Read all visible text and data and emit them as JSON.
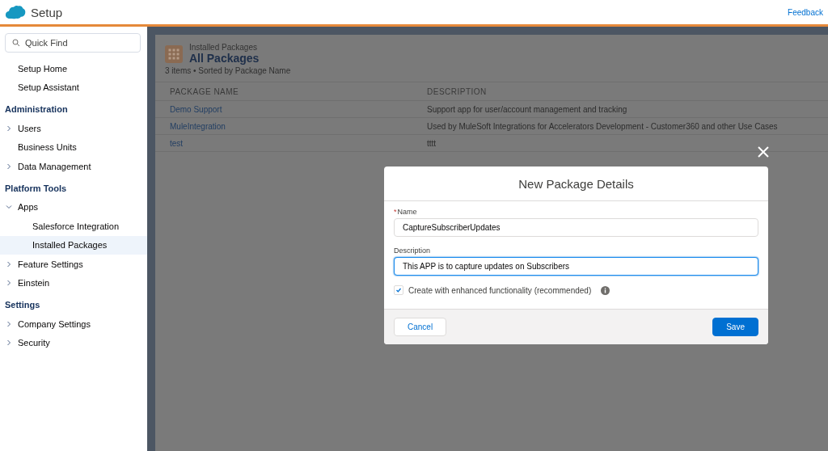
{
  "header": {
    "title": "Setup",
    "feedback_link": "Feedback"
  },
  "sidebar": {
    "search": {
      "placeholder": "Quick Find"
    },
    "groups": [
      {
        "items": [
          {
            "label": "Setup Home",
            "selected": false
          },
          {
            "label": "Setup Assistant",
            "selected": false
          }
        ]
      },
      {
        "heading": "Administration",
        "items": [
          {
            "label": "Users",
            "selected": false,
            "expanded": false
          },
          {
            "label": "Business Units",
            "selected": false
          },
          {
            "label": "Data Management",
            "selected": false,
            "expanded": false
          }
        ]
      },
      {
        "heading": "Platform Tools",
        "items": [
          {
            "label": "Apps",
            "selected": false,
            "expanded": true,
            "children": [
              {
                "label": "Salesforce Integration",
                "selected": false
              },
              {
                "label": "Installed Packages",
                "selected": true
              }
            ]
          },
          {
            "label": "Feature Settings",
            "selected": false,
            "expanded": false
          },
          {
            "label": "Einstein",
            "selected": false,
            "expanded": false
          }
        ]
      },
      {
        "heading": "Settings",
        "items": [
          {
            "label": "Company Settings",
            "selected": false,
            "expanded": false
          },
          {
            "label": "Security",
            "selected": false,
            "expanded": false
          }
        ]
      }
    ]
  },
  "list_view": {
    "eyebrow": "Installed Packages",
    "title": "All Packages",
    "summary": "3 items • Sorted by Package Name",
    "table": {
      "columns": [
        "PACKAGE NAME",
        "DESCRIPTION"
      ],
      "rows": [
        [
          "Demo Support",
          "Support app for user/account management and tracking"
        ],
        [
          "MuleIntegration",
          "Used by MuleSoft Integrations for Accelerators Development - Customer360 and other Use Cases"
        ],
        [
          "test",
          "tttt"
        ]
      ]
    }
  },
  "modal": {
    "title": "New Package Details",
    "fields": [
      {
        "label": "Name",
        "required_mark": "*",
        "value": "CaptureSubscriberUpdates",
        "focused": false
      },
      {
        "label": "Description",
        "value": "This APP is to capture updates on Subscribers",
        "focused": true
      }
    ],
    "checkbox": {
      "label": "Create with enhanced functionality (recommended)",
      "checked": true
    },
    "buttons": [
      {
        "label": "Cancel",
        "kind": "neutral"
      },
      {
        "label": "Save",
        "kind": "brand"
      }
    ]
  }
}
